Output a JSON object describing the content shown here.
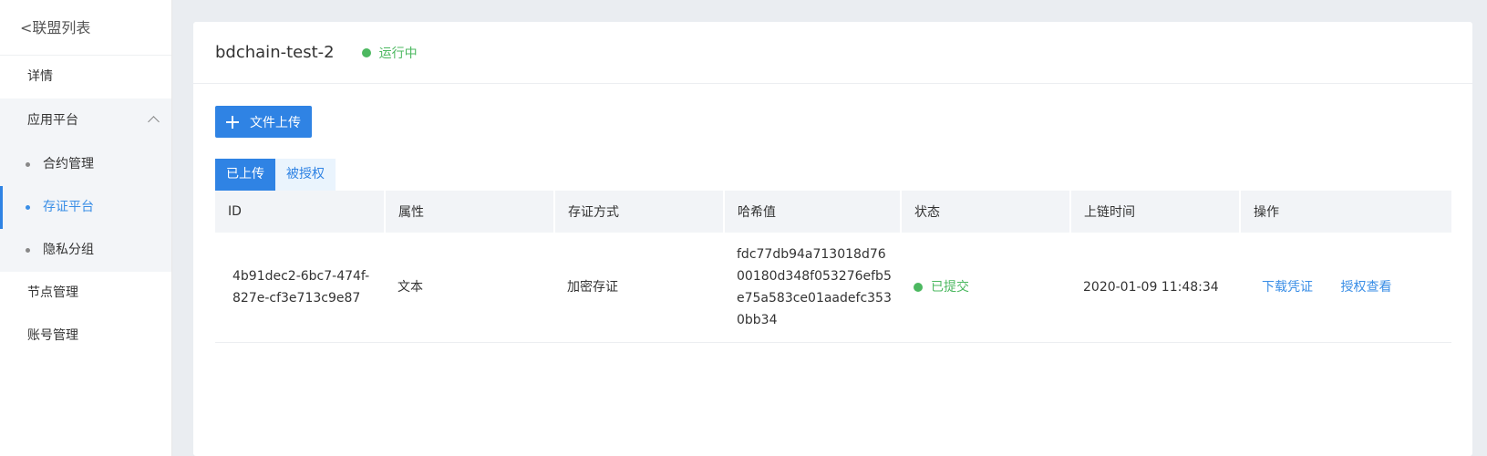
{
  "sidebar": {
    "back": "<联盟列表",
    "details": "详情",
    "app_platform": "应用平台",
    "sub": [
      "合约管理",
      "存证平台",
      "隐私分组"
    ],
    "nodes": "节点管理",
    "accounts": "账号管理"
  },
  "main": {
    "title": "bdchain-test-2",
    "status": "运行中",
    "upload": "文件上传",
    "tabs": [
      "已上传",
      "被授权"
    ],
    "columns": [
      "ID",
      "属性",
      "存证方式",
      "哈希值",
      "状态",
      "上链时间",
      "操作"
    ],
    "row": {
      "id": "4b91dec2-6bc7-474f-827e-cf3e713c9e87",
      "attr": "文本",
      "method": "加密存证",
      "hash": "fdc77db94a713018d7600180d348f053276efb5e75a583ce01aadefc3530bb34",
      "status": "已提交",
      "time": "2020-01-09 11:48:34",
      "action_download": "下载凭证",
      "action_auth": "授权查看"
    }
  },
  "colors": {
    "accent": "#2f83e4",
    "success": "#4cb860"
  },
  "icons": [
    "chevron-up-icon",
    "plus-icon",
    "status-dot-icon"
  ]
}
